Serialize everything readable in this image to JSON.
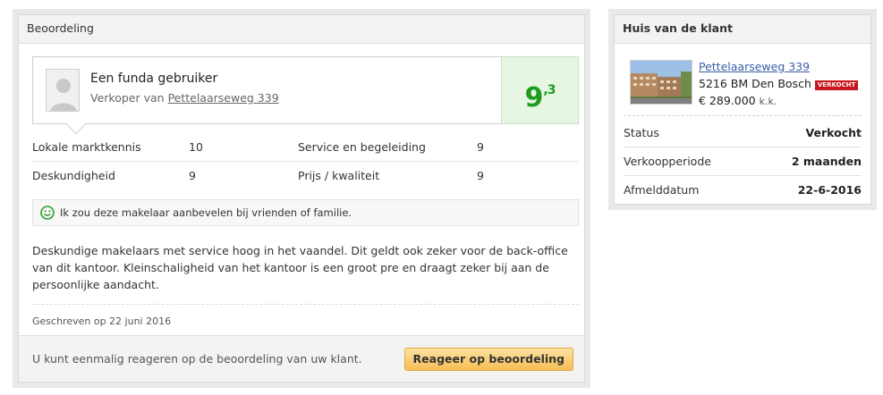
{
  "review_panel": {
    "title": "Beoordeling",
    "reviewer_name": "Een funda gebruiker",
    "reviewer_role": "Verkoper van",
    "reviewer_property_link": "Pettelaarseweg 339",
    "score_main": "9",
    "score_decimal": ",3",
    "ratings": [
      {
        "label": "Lokale marktkennis",
        "value": "10"
      },
      {
        "label": "Service en begeleiding",
        "value": "9"
      },
      {
        "label": "Deskundigheid",
        "value": "9"
      },
      {
        "label": "Prijs / kwaliteit",
        "value": "9"
      }
    ],
    "recommend_text": "Ik zou deze makelaar aanbevelen bij vrienden of familie.",
    "review_text": "Deskundige makelaars met service hoog in het vaandel. Dit geldt ook zeker voor de back-office van dit kantoor. Kleinschaligheid van het kantoor is een groot pre en draagt zeker bij aan de persoonlijke aandacht.",
    "written": "Geschreven op 22 juni 2016",
    "footer_text": "U kunt eenmalig reageren op de beoordeling van uw klant.",
    "react_button": "Reageer op beoordeling"
  },
  "house_panel": {
    "title": "Huis van de klant",
    "address_link": "Pettelaarseweg 339",
    "zip_city": "5216 BM Den Bosch",
    "badge": "VERKOCHT",
    "price": "€ 289.000",
    "price_suffix": "k.k.",
    "details": [
      {
        "label": "Status",
        "value": "Verkocht"
      },
      {
        "label": "Verkoopperiode",
        "value": "2 maanden"
      },
      {
        "label": "Afmelddatum",
        "value": "22-6-2016"
      }
    ]
  },
  "colors": {
    "score_green": "#1f9c1f",
    "score_bg": "#e7f5e3",
    "button_orange": "#f6be55",
    "badge_red": "#c8161d",
    "link_blue": "#3a5fa6"
  }
}
